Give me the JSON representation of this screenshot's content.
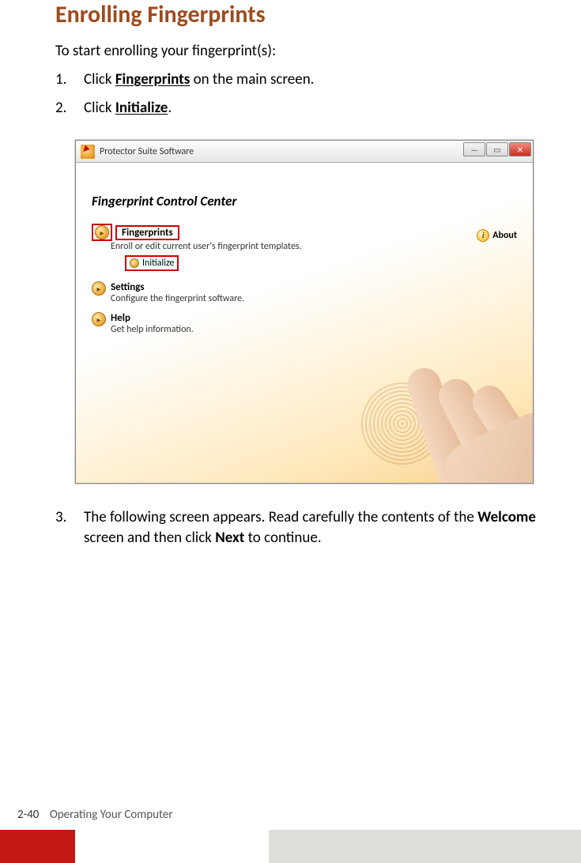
{
  "page": {
    "title": "Enrolling Fingerprints",
    "intro": "To start enrolling your fingerprint(s):",
    "step1": {
      "num": "1.",
      "pre": "Click ",
      "bold": "Fingerprints",
      "post": " on the main screen."
    },
    "step2": {
      "num": "2.",
      "pre": "Click ",
      "bold": "Initialize",
      "post": "."
    },
    "step3": {
      "num": "3.",
      "text_a": "The following screen appears. Read carefully the contents of the ",
      "bold1": "Welcome",
      "text_b": " screen and then click ",
      "bold2": "Next",
      "text_c": " to continue."
    }
  },
  "window": {
    "title": "Protector Suite Software",
    "heading": "Fingerprint Control Center",
    "about": "About",
    "fingerprints": {
      "title": "Fingerprints",
      "desc": "Enroll or edit current user's fingerprint templates.",
      "initialize": "Initialize"
    },
    "settings": {
      "title": "Settings",
      "desc": "Configure the fingerprint software."
    },
    "help": {
      "title": "Help",
      "desc": "Get help information."
    }
  },
  "footer": {
    "page": "2-40",
    "section": "Operating Your Computer"
  }
}
